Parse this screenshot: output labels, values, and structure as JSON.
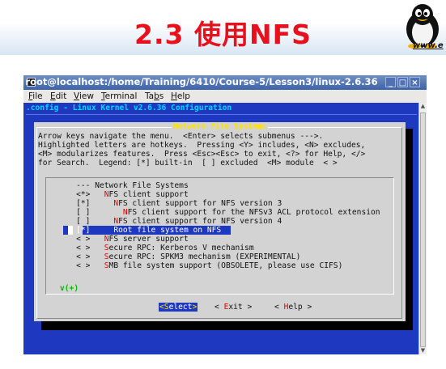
{
  "slide": {
    "title": "2.3 使用NFS",
    "url": "www.e"
  },
  "window": {
    "title": "root@localhost:/home/Training/6410/Course-5/Lesson3/linux-2.6.36",
    "buttons": [
      "_",
      "□",
      "×"
    ]
  },
  "menubar": {
    "items": [
      {
        "key": "F",
        "rest": "ile"
      },
      {
        "key": "E",
        "rest": "dit"
      },
      {
        "key": "V",
        "rest": "iew"
      },
      {
        "key": "T",
        "rest": "erminal"
      },
      {
        "pre": "Ta",
        "key": "b",
        "rest": "s"
      },
      {
        "key": "H",
        "rest": "elp"
      }
    ]
  },
  "config": {
    "header": ".config - Linux Kernel v2.6.36 Configuration",
    "dialog_title": "Network File Systems",
    "help_lines": [
      "Arrow keys navigate the menu.  <Enter> selects submenus --->.",
      "Highlighted letters are hotkeys.  Pressing <Y> includes, <N> excludes,",
      "<M> modularizes features.  Press <Esc><Esc> to exit, <?> for Help, </>",
      "for Search.  Legend: [*] built-in  [ ] excluded  <M> module  < >"
    ],
    "items": [
      {
        "prefix": "    --- ",
        "hk": "",
        "rest": "Network File Systems"
      },
      {
        "prefix": "    <*>   ",
        "hk": "N",
        "rest": "FS client support"
      },
      {
        "prefix": "    [*]     ",
        "hk": "N",
        "rest": "FS client support for NFS version 3"
      },
      {
        "prefix": "    [ ]       ",
        "hk": "N",
        "rest": "FS client support for the NFSv3 ACL protocol extension"
      },
      {
        "prefix": "    [ ]     ",
        "hk": "N",
        "rest": "FS client support for NFS version 4"
      },
      {
        "prefix": "    [*]     ",
        "hk": "",
        "rest": "Root file system on NFS"
      },
      {
        "prefix": "    < >   ",
        "hk": "N",
        "rest": "FS server support"
      },
      {
        "prefix": "    < >   ",
        "hk": "S",
        "rest": "ecure RPC: Kerberos V mechanism"
      },
      {
        "prefix": "    < >   ",
        "hk": "S",
        "rest": "ecure RPC: SPKM3 mechanism (EXPERIMENTAL)"
      },
      {
        "prefix": "    < >   ",
        "hk": "S",
        "rest": "MB file system support (OBSOLETE, please use CIFS)"
      }
    ],
    "selected_index": 5,
    "more_indicator": "v(+)",
    "buttons": [
      {
        "pre": "<",
        "hk": "S",
        "rest": "elect",
        "post": ">"
      },
      {
        "pre": "< ",
        "hk": "E",
        "rest": "xit",
        "post": " >"
      },
      {
        "pre": "< ",
        "hk": "H",
        "rest": "elp",
        "post": " >"
      }
    ]
  },
  "colors": {
    "slide_title": "#e8101c",
    "terminal_bg": "#1e38c0",
    "dialog_bg": "#d3d3d3",
    "hotkey": "#e00000",
    "dialog_title": "#ffe000",
    "config_header": "#00d8ff"
  }
}
